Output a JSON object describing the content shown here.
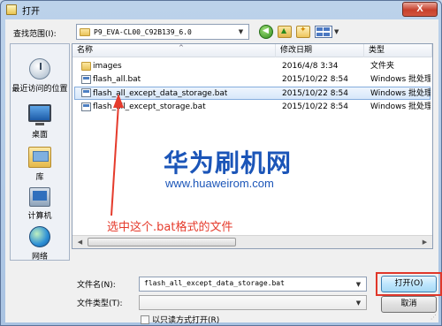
{
  "window": {
    "title": "打开",
    "close_symbol": "X"
  },
  "toolbar": {
    "look_in_label": "查找范围(I):",
    "look_in_value": "P9_EVA-CL00_C92B139_6.0",
    "icons": [
      "back-icon",
      "up-folder-icon",
      "new-folder-icon",
      "view-menu-icon"
    ]
  },
  "places": [
    {
      "label": "最近访问的位置",
      "icon": "recent-places-icon"
    },
    {
      "label": "桌面",
      "icon": "desktop-icon"
    },
    {
      "label": "库",
      "icon": "libraries-icon"
    },
    {
      "label": "计算机",
      "icon": "computer-icon"
    },
    {
      "label": "网络",
      "icon": "network-icon"
    }
  ],
  "file_list": {
    "columns": [
      "名称",
      "修改日期",
      "类型"
    ],
    "rows": [
      {
        "name": "images",
        "date": "2016/4/8 3:34",
        "type": "文件夹",
        "icon": "folder-icon",
        "selected": false
      },
      {
        "name": "flash_all.bat",
        "date": "2015/10/22 8:54",
        "type": "Windows 批处理文",
        "icon": "bat-file-icon",
        "selected": false
      },
      {
        "name": "flash_all_except_data_storage.bat",
        "date": "2015/10/22 8:54",
        "type": "Windows 批处理文",
        "icon": "bat-file-icon",
        "selected": true
      },
      {
        "name": "flash_all_except_storage.bat",
        "date": "2015/10/22 8:54",
        "type": "Windows 批处理文",
        "icon": "bat-file-icon",
        "selected": false
      }
    ]
  },
  "watermark": {
    "title": "华为刷机网",
    "url": "www.huaweirom.com"
  },
  "annotation": {
    "text": "选中这个.bat格式的文件",
    "color": "#e53b2c"
  },
  "form": {
    "filename_label": "文件名(N):",
    "filename_value": "flash_all_except_data_storage.bat",
    "filetype_label": "文件类型(T):",
    "filetype_value": "",
    "readonly_label": "以只读方式打开(R)",
    "open_button": "打开(O)",
    "cancel_button": "取消"
  },
  "colors": {
    "highlight_outline": "#e0372a",
    "watermark": "#1b55b8",
    "selection": "#d7e7fa"
  }
}
